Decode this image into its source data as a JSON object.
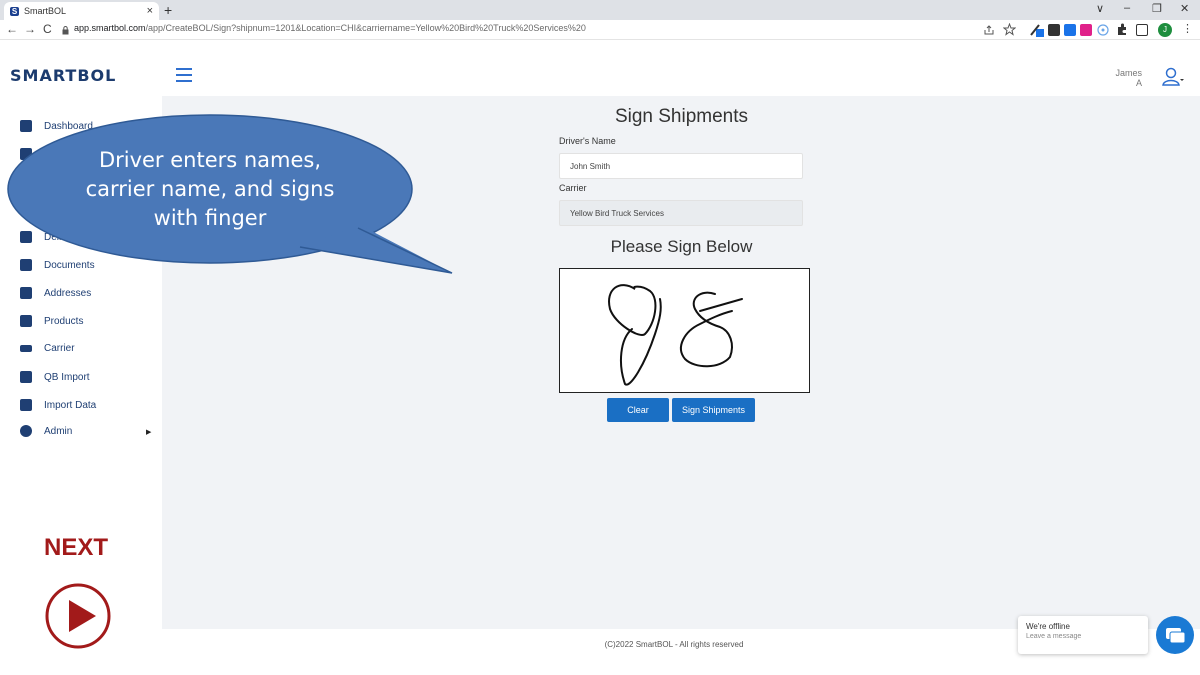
{
  "browser": {
    "tab_title": "SmartBOL",
    "tab_close": "×",
    "new_tab": "+",
    "favicon_letter": "S",
    "url_host": "app.smartbol.com",
    "url_path": "/app/CreateBOL/Sign?shipnum=1201&Location=CHI&carriername=Yellow%20Bird%20Truck%20Services%20",
    "back": "←",
    "forward": "→",
    "reload": "C",
    "win_dropdown": "∨",
    "win_minimize": "–",
    "win_restore": "❐",
    "win_close": "✕",
    "menu": "⋮",
    "profile_letter": "J"
  },
  "header": {
    "logo_text": "SMARTBOL",
    "user_name": "James",
    "user_initial": "A"
  },
  "sidebar": {
    "items": [
      {
        "label": "Dashboard",
        "icon": "dashboard-icon"
      },
      {
        "label": "Deliv",
        "icon": "delivery-icon"
      },
      {
        "label": "Documents",
        "icon": "document-icon"
      },
      {
        "label": "Addresses",
        "icon": "address-book-icon"
      },
      {
        "label": "Products",
        "icon": "products-icon"
      },
      {
        "label": "Carrier",
        "icon": "truck-icon"
      },
      {
        "label": "QB Import",
        "icon": "import-icon"
      },
      {
        "label": "Import Data",
        "icon": "import-icon"
      },
      {
        "label": "Admin",
        "icon": "admin-icon"
      }
    ],
    "admin_arrow": "▶"
  },
  "form": {
    "title": "Sign Shipments",
    "driver_label": "Driver's Name",
    "driver_value": "John Smith",
    "carrier_label": "Carrier",
    "carrier_value": "Yellow Bird Truck Services",
    "sign_title": "Please Sign Below",
    "clear_button": "Clear",
    "sign_button": "Sign Shipments"
  },
  "callout": {
    "line1": "Driver enters names,",
    "line2": "carrier name, and signs",
    "line3": "with finger",
    "color": "#4a78b8"
  },
  "overlay": {
    "next_label": "NEXT",
    "next_color": "#a21a1a"
  },
  "footer": {
    "copyright": "(C)2022 SmartBOL - All rights reserved"
  },
  "chat": {
    "status": "We're offline",
    "prompt": "Leave a message"
  }
}
